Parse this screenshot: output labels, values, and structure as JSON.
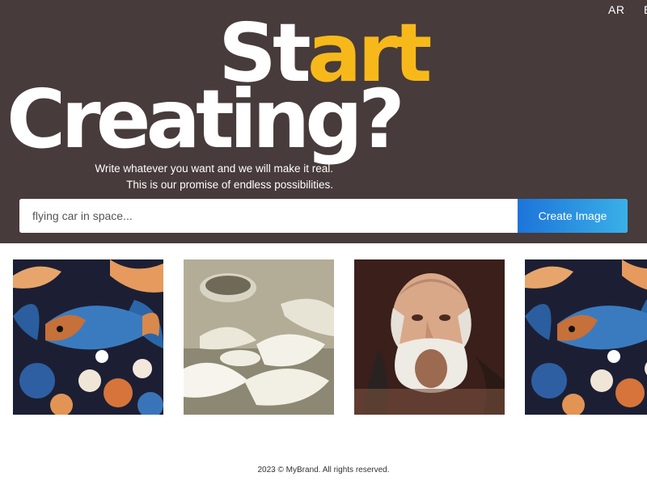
{
  "header": {
    "lang_label": "AR",
    "lang_extra": "EN"
  },
  "hero": {
    "title_start_prefix": "St",
    "title_start_accent": "art",
    "title_line2": "Creating?",
    "tagline_line1": "Write whatever you want and we will make it real.",
    "tagline_line2": "This is our promise of endless possibilities."
  },
  "search": {
    "placeholder": "flying car in space...",
    "value": "",
    "button_label": "Create Image"
  },
  "gallery": [
    {
      "name": "fish-floral-art"
    },
    {
      "name": "white-bowls-art"
    },
    {
      "name": "bearded-man-portrait"
    },
    {
      "name": "fish-floral-art"
    }
  ],
  "footer": {
    "text": "2023 © MyBrand. All rights reserved."
  },
  "colors": {
    "hero_bg": "#473b3b",
    "accent": "#f7b91a",
    "button_start": "#1d74d9",
    "button_end": "#3ab0e8"
  }
}
